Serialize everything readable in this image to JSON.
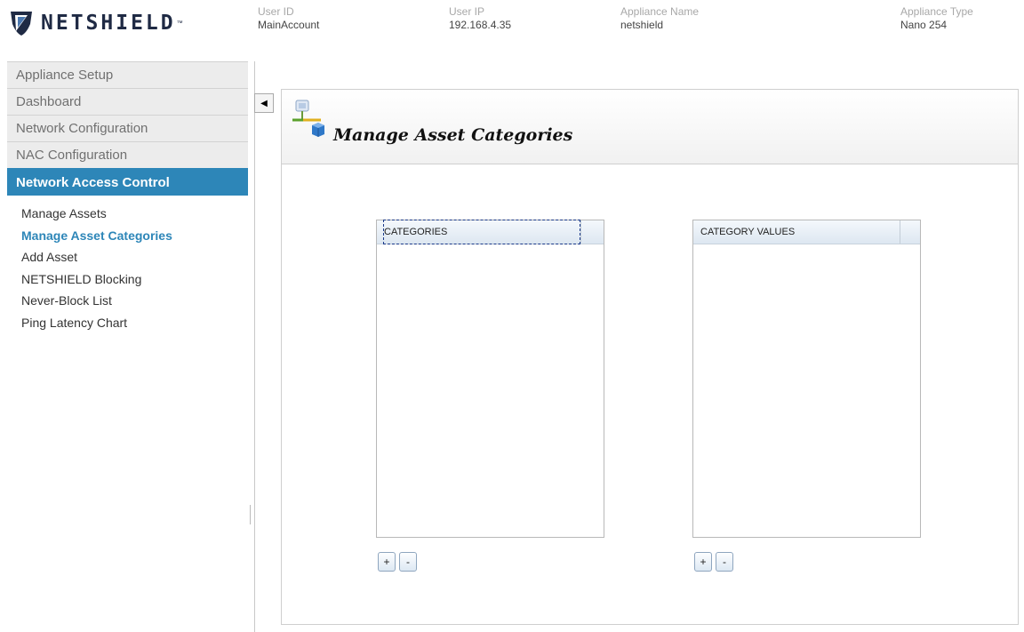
{
  "brand": {
    "name": "NETSHIELD",
    "tm": "™"
  },
  "header": {
    "user_id": {
      "label": "User ID",
      "value": "MainAccount"
    },
    "user_ip": {
      "label": "User IP",
      "value": "192.168.4.35"
    },
    "appliance_name": {
      "label": "Appliance Name",
      "value": "netshield"
    },
    "appliance_type": {
      "label": "Appliance Type",
      "value": "Nano 254"
    }
  },
  "sidebar": {
    "sections": [
      "Appliance Setup",
      "Dashboard",
      "Network Configuration",
      "NAC Configuration",
      "Network Access Control"
    ],
    "sub_items": [
      "Manage Assets",
      "Manage Asset Categories",
      "Add Asset",
      "NETSHIELD Blocking",
      "Never-Block List",
      "Ping Latency Chart"
    ]
  },
  "page": {
    "title": "Manage Asset Categories",
    "collapse_glyph": "◀"
  },
  "categories": {
    "header": "CATEGORIES",
    "add": "+",
    "remove": "-"
  },
  "category_values": {
    "header": "CATEGORY VALUES",
    "add": "+",
    "remove": "-"
  },
  "colors": {
    "accent": "#2d86b8",
    "sidebar_bg": "#ececec"
  }
}
